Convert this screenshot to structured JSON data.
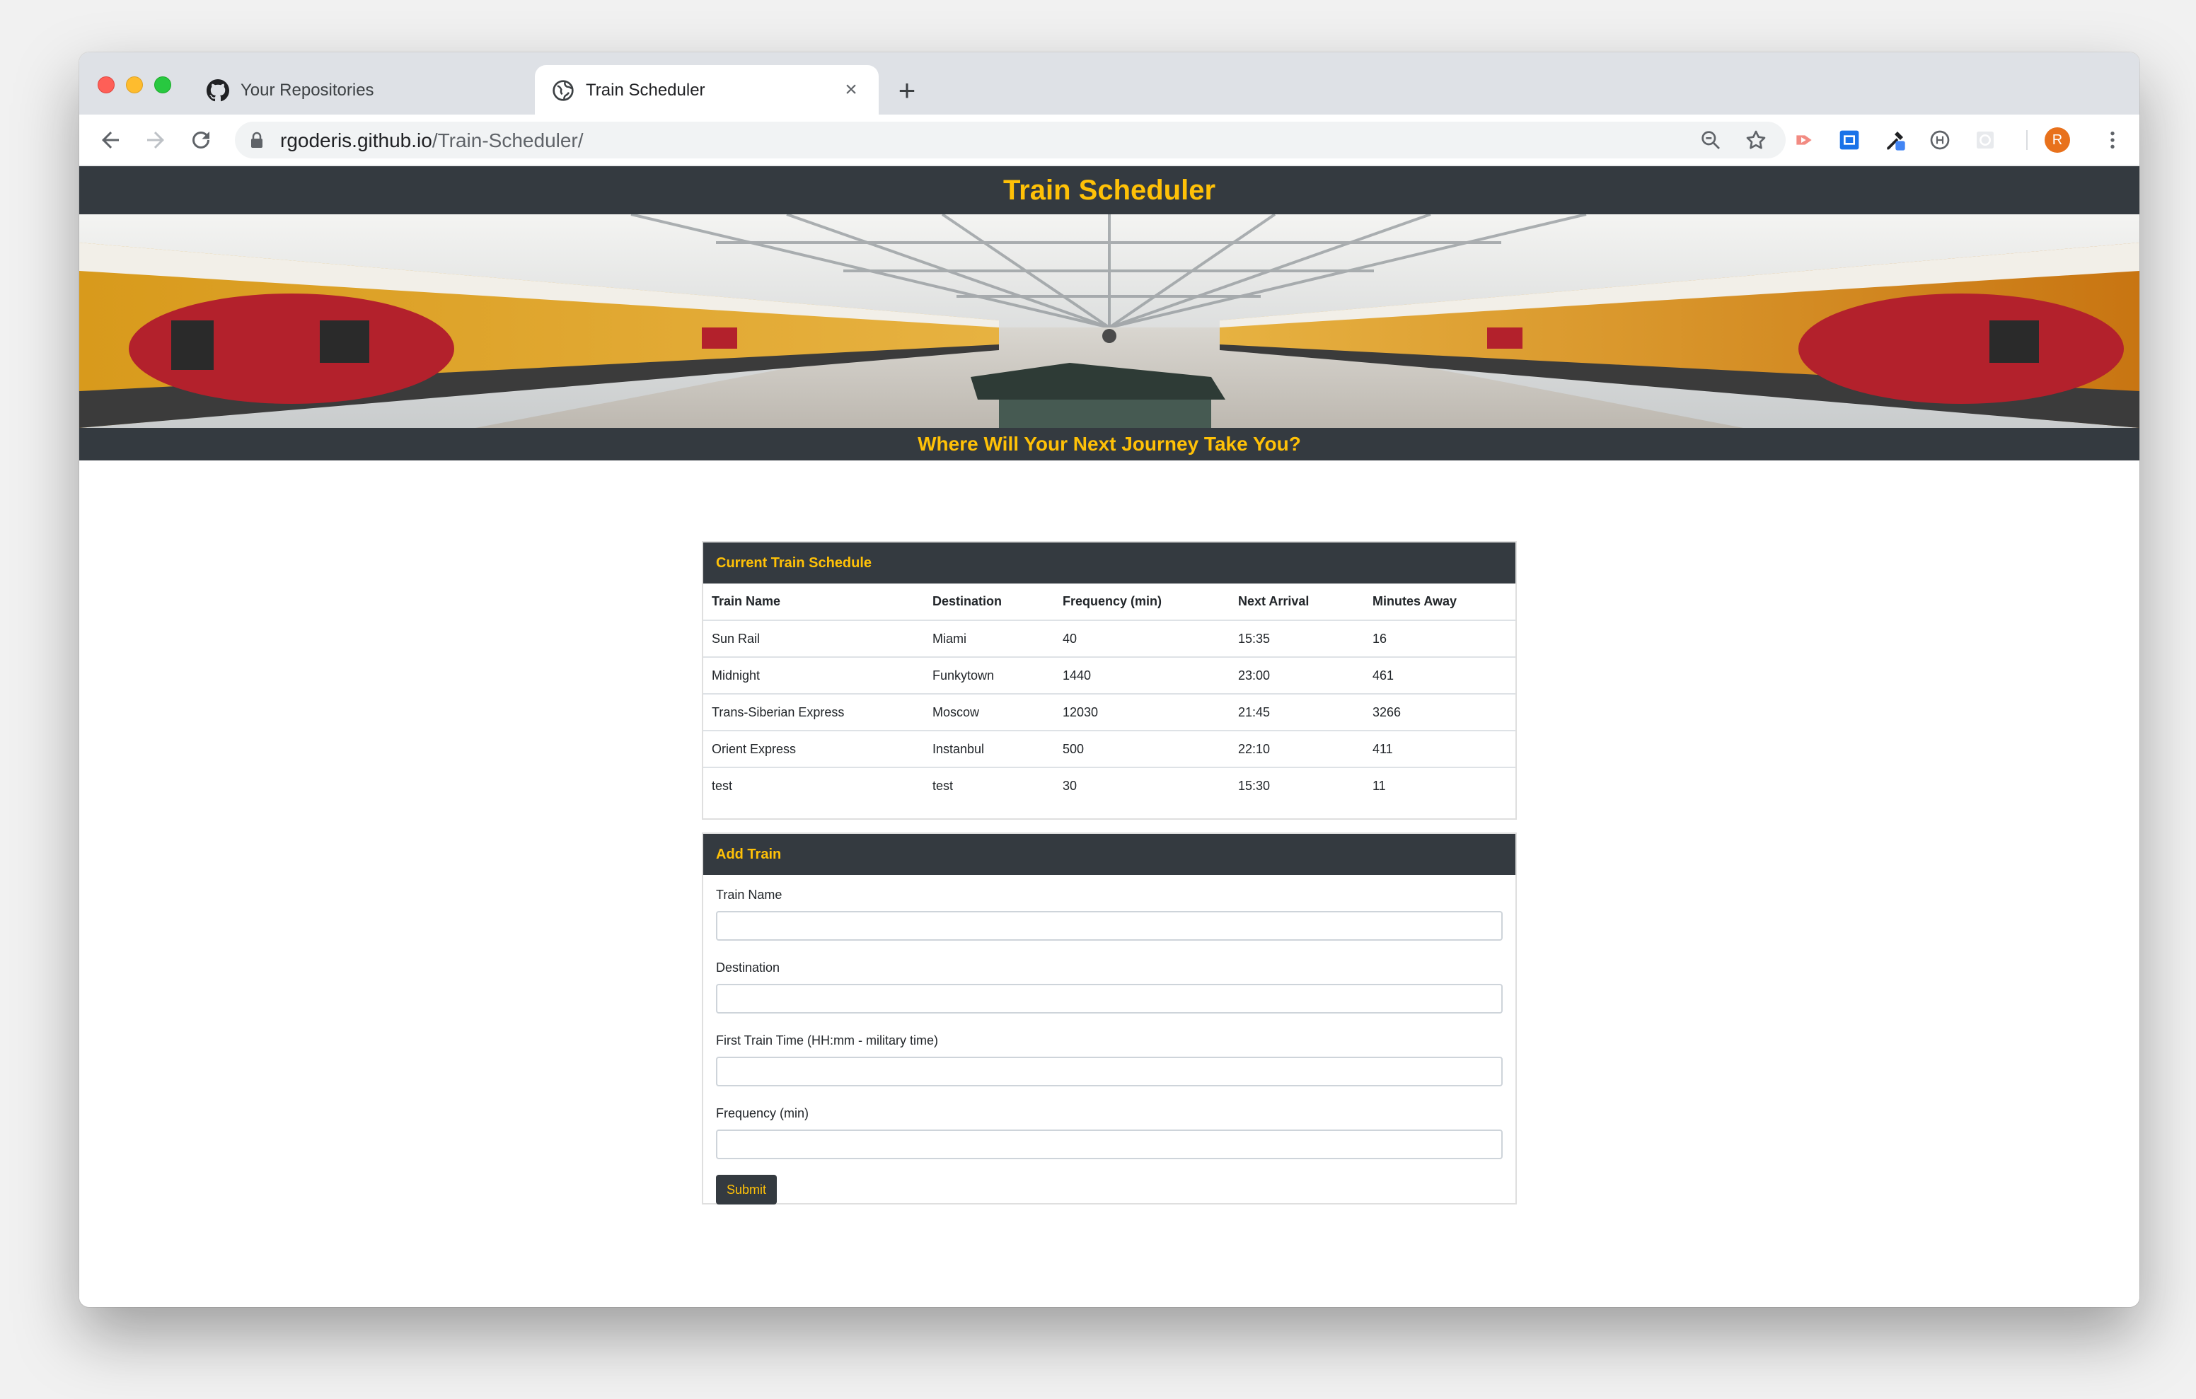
{
  "browser": {
    "tabs": [
      {
        "title": "Your Repositories",
        "icon": "github-icon",
        "active": false
      },
      {
        "title": "Train Scheduler",
        "icon": "globe-icon",
        "active": true
      }
    ],
    "close_glyph": "×",
    "new_tab_glyph": "+",
    "address": {
      "host": "rgoderis.github.io",
      "path": "/Train-Scheduler/"
    },
    "profile_initial": "R",
    "accent": "#e8711c"
  },
  "site": {
    "title": "Train Scheduler",
    "tagline": "Where Will Your Next Journey Take You?",
    "colors": {
      "dark": "#343a40",
      "accent": "#ffc107"
    }
  },
  "schedule": {
    "heading": "Current Train Schedule",
    "columns": [
      "Train Name",
      "Destination",
      "Frequency (min)",
      "Next Arrival",
      "Minutes Away"
    ],
    "rows": [
      [
        "Sun Rail",
        "Miami",
        "40",
        "15:35",
        "16"
      ],
      [
        "Midnight",
        "Funkytown",
        "1440",
        "23:00",
        "461"
      ],
      [
        "Trans-Siberian Express",
        "Moscow",
        "12030",
        "21:45",
        "3266"
      ],
      [
        "Orient Express",
        "Instanbul",
        "500",
        "22:10",
        "411"
      ],
      [
        "test",
        "test",
        "30",
        "15:30",
        "11"
      ]
    ]
  },
  "add_train": {
    "heading": "Add Train",
    "fields": {
      "name": {
        "label": "Train Name",
        "value": "",
        "placeholder": ""
      },
      "destination": {
        "label": "Destination",
        "value": "",
        "placeholder": ""
      },
      "first_time": {
        "label": "First Train Time (HH:mm - military time)",
        "value": "",
        "placeholder": ""
      },
      "frequency": {
        "label": "Frequency (min)",
        "value": "",
        "placeholder": ""
      }
    },
    "submit_label": "Submit"
  }
}
